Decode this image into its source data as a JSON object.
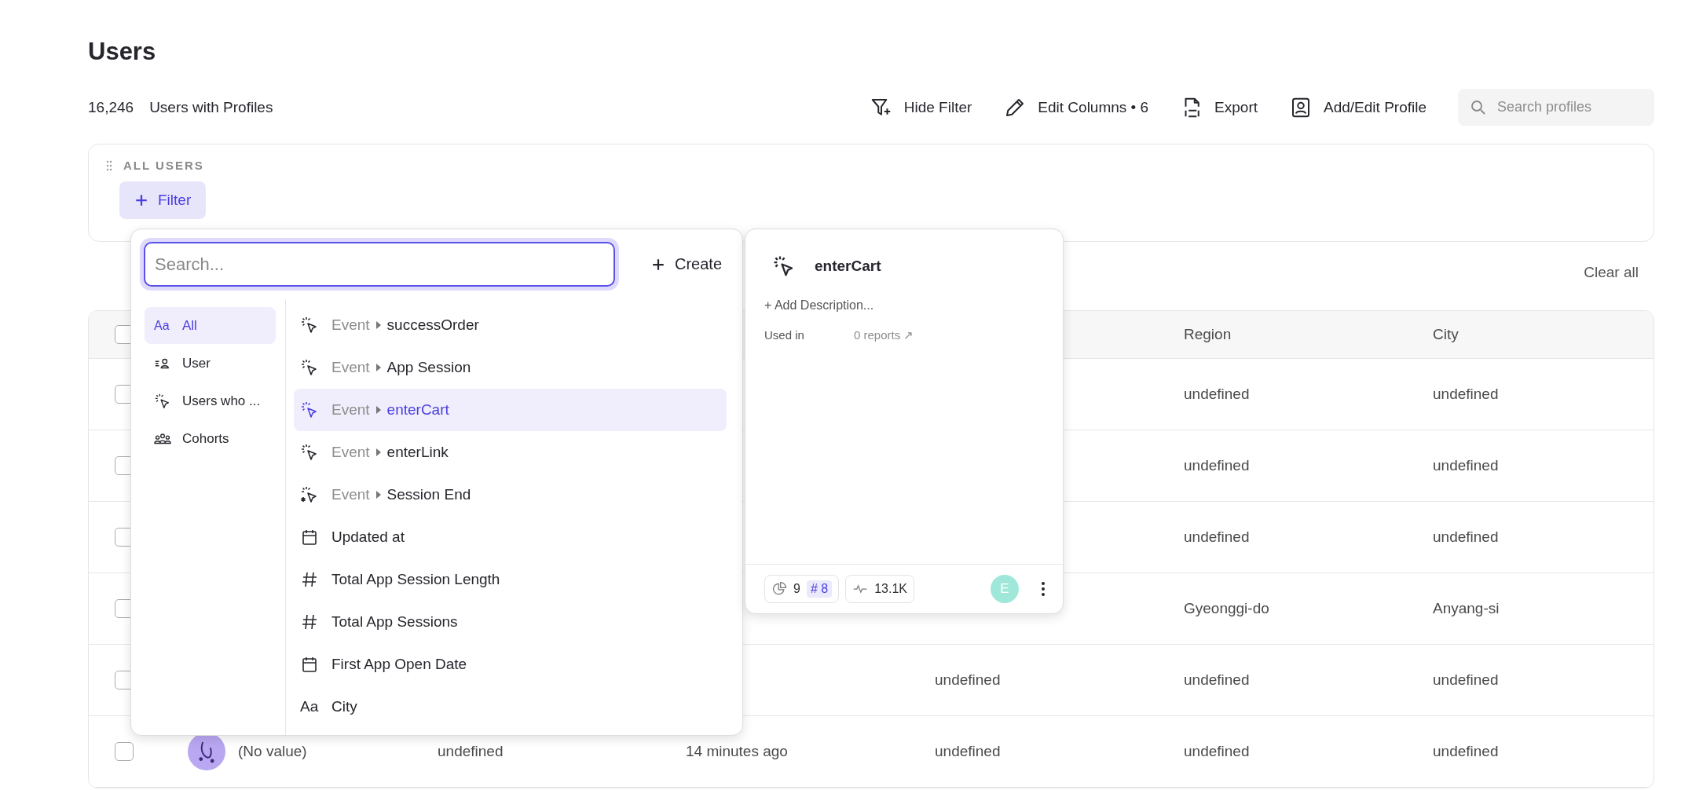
{
  "page": {
    "title": "Users"
  },
  "summary": {
    "count": "16,246",
    "label": "Users with Profiles"
  },
  "toolbar": [
    {
      "kind": "filter",
      "label": "Hide Filter"
    },
    {
      "kind": "pencil",
      "label": "Edit Columns • 6"
    },
    {
      "kind": "csv",
      "label": "Export"
    },
    {
      "kind": "profile",
      "label": "Add/Edit Profile"
    }
  ],
  "search": {
    "placeholder": "Search profiles"
  },
  "filter_panel": {
    "heading": "ALL USERS",
    "button": "Filter"
  },
  "clear_all": "Clear all",
  "table": {
    "select_all": {
      "checked": false
    },
    "columns": [
      {
        "label": "Region"
      },
      {
        "label": "City"
      }
    ],
    "rows": [
      {
        "checked": false,
        "region": "undefined",
        "city": "undefined"
      },
      {
        "checked": false,
        "region": "undefined",
        "city": "undefined"
      },
      {
        "checked": false,
        "region": "undefined",
        "city": "undefined"
      },
      {
        "checked": false,
        "region": "Gyeonggi-do",
        "city": "Anyang-si"
      },
      {
        "checked": false,
        "column_5": "undefined",
        "region": "undefined",
        "city": "undefined"
      },
      {
        "checked": false,
        "name": "(No value)",
        "column_3": "undefined",
        "column_4": "14 minutes ago",
        "column_5": "undefined",
        "region": "undefined",
        "city": "undefined"
      }
    ]
  },
  "filter_menu": {
    "search_placeholder": "Search...",
    "create": "Create",
    "categories": [
      {
        "kind": "text",
        "icon_text": "Aa",
        "label": "All",
        "selected": true
      },
      {
        "kind": "user",
        "label": "User",
        "selected": false
      },
      {
        "kind": "event",
        "label": "Users who ...",
        "selected": false
      },
      {
        "kind": "cohort",
        "label": "Cohorts",
        "selected": false
      }
    ],
    "items": [
      {
        "kind": "event",
        "prefix": "Event",
        "label": "successOrder",
        "selected": false
      },
      {
        "kind": "event",
        "prefix": "Event",
        "label": "App Session",
        "selected": false
      },
      {
        "kind": "event",
        "prefix": "Event",
        "label": "enterCart",
        "selected": true
      },
      {
        "kind": "event",
        "prefix": "Event",
        "label": "enterLink",
        "selected": false
      },
      {
        "kind": "event_end",
        "prefix": "Event",
        "label": "Session End",
        "selected": false
      },
      {
        "kind": "date",
        "label": "Updated at",
        "selected": false
      },
      {
        "kind": "number",
        "label": "Total App Session Length",
        "selected": false
      },
      {
        "kind": "number",
        "label": "Total App Sessions",
        "selected": false
      },
      {
        "kind": "date",
        "label": "First App Open Date",
        "selected": false
      },
      {
        "kind": "text",
        "icon_text": "Aa",
        "label": "City",
        "selected": false
      }
    ]
  },
  "detail_card": {
    "title": "enterCart",
    "add_description": "+ Add Description...",
    "used_in_label": "Used in",
    "used_in_value": "0 reports ↗",
    "reports_count": "9",
    "tag": "# 8",
    "volume": "13.1K",
    "owner_initial": "E"
  }
}
